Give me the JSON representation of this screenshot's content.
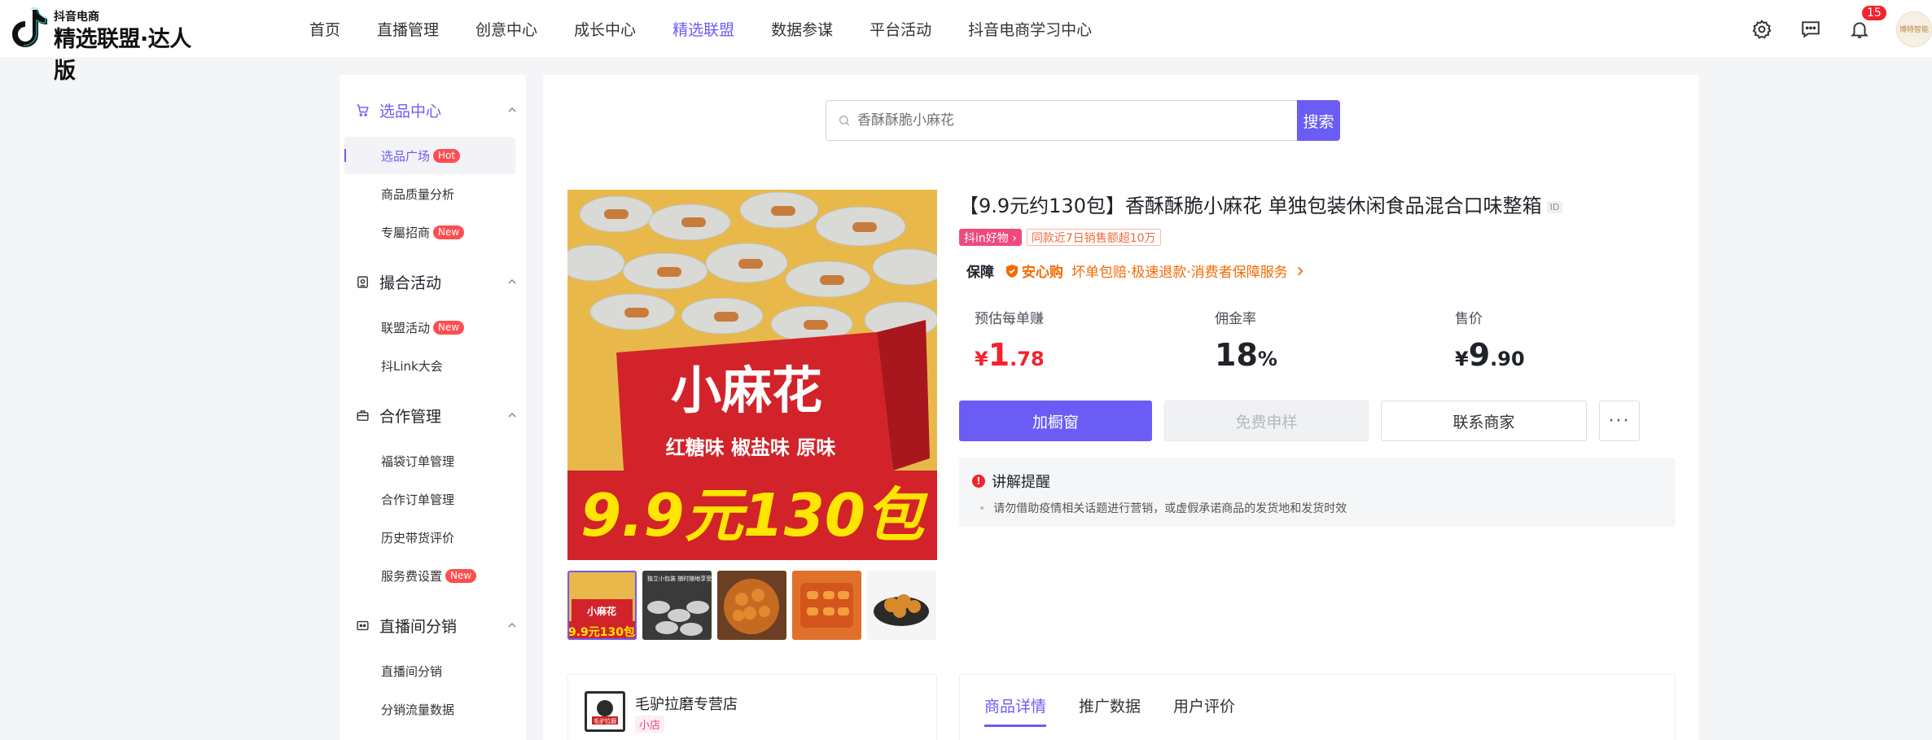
{
  "app": {
    "logo_sub": "抖音电商",
    "logo_main": "精选联盟·达人版"
  },
  "nav": {
    "items": [
      "首页",
      "直播管理",
      "创意中心",
      "成长中心",
      "精选联盟",
      "数据参谋",
      "平台活动",
      "抖音电商学习中心"
    ],
    "active_index": 4
  },
  "header": {
    "notification_count": "15",
    "avatar_text": "博特智能"
  },
  "sidebar": {
    "sections": [
      {
        "title": "选品中心",
        "icon": "cart-icon",
        "items": [
          {
            "label": "选品广场",
            "tag": "Hot"
          },
          {
            "label": "商品质量分析",
            "tag": ""
          },
          {
            "label": "专屬招商",
            "tag": "New"
          }
        ]
      },
      {
        "title": "撮合活动",
        "icon": "activity-icon",
        "items": [
          {
            "label": "联盟活动",
            "tag": "New"
          },
          {
            "label": "抖Link大会",
            "tag": ""
          }
        ]
      },
      {
        "title": "合作管理",
        "icon": "briefcase-icon",
        "items": [
          {
            "label": "福袋订单管理",
            "tag": ""
          },
          {
            "label": "合作订单管理",
            "tag": ""
          },
          {
            "label": "历史带货评价",
            "tag": ""
          },
          {
            "label": "服务费设置",
            "tag": "New"
          }
        ]
      },
      {
        "title": "直播间分销",
        "icon": "live-icon",
        "items": [
          {
            "label": "直播间分销",
            "tag": ""
          },
          {
            "label": "分销流量数据",
            "tag": ""
          }
        ]
      }
    ]
  },
  "search": {
    "placeholder": "香酥酥脆小麻花",
    "button": "搜索"
  },
  "hero": {
    "headline": "小麻花",
    "flavors": "红糖味 椒盐味 原味",
    "promo": "9.9元130包"
  },
  "thumb_captions": {
    "t2": "独立小包装 随时随地享受"
  },
  "product": {
    "title": "【9.9元约130包】香酥酥脆小麻花 单独包装休闲食品混合口味整箱",
    "id_label": "ID",
    "chip_pink": "抖in好物 ›",
    "chip_sales": "同款近7日销售额超10万",
    "guarantee_label": "保障",
    "guarantee_brand": "安心购",
    "guarantee_text": "坏单包赔·极速退款·消费者保障服务",
    "stats": {
      "earn_label": "预估每单赚",
      "earn_currency": "¥",
      "earn_int": "1",
      "earn_dec": ".78",
      "rate_label": "佣金率",
      "rate_int": "18",
      "rate_unit": "%",
      "price_label": "售价",
      "price_currency": "¥",
      "price_int": "9",
      "price_dec": ".90"
    },
    "actions": {
      "add": "加橱窗",
      "sample": "免费申样",
      "contact": "联系商家",
      "more": "···"
    },
    "notice_title": "讲解提醒",
    "notice_text": "请勿借助疫情相关话题进行营销，或虚假承诺商品的发货地和发货时效"
  },
  "store": {
    "name": "毛驴拉磨专营店",
    "tag": "小店",
    "logo_text": "毛驴拉磨"
  },
  "detail_tabs": [
    "商品详情",
    "推广数据",
    "用户评价"
  ],
  "colors": {
    "accent": "#6b5cf6",
    "price_red": "#f5222d",
    "guarantee_orange": "#f56a00"
  }
}
